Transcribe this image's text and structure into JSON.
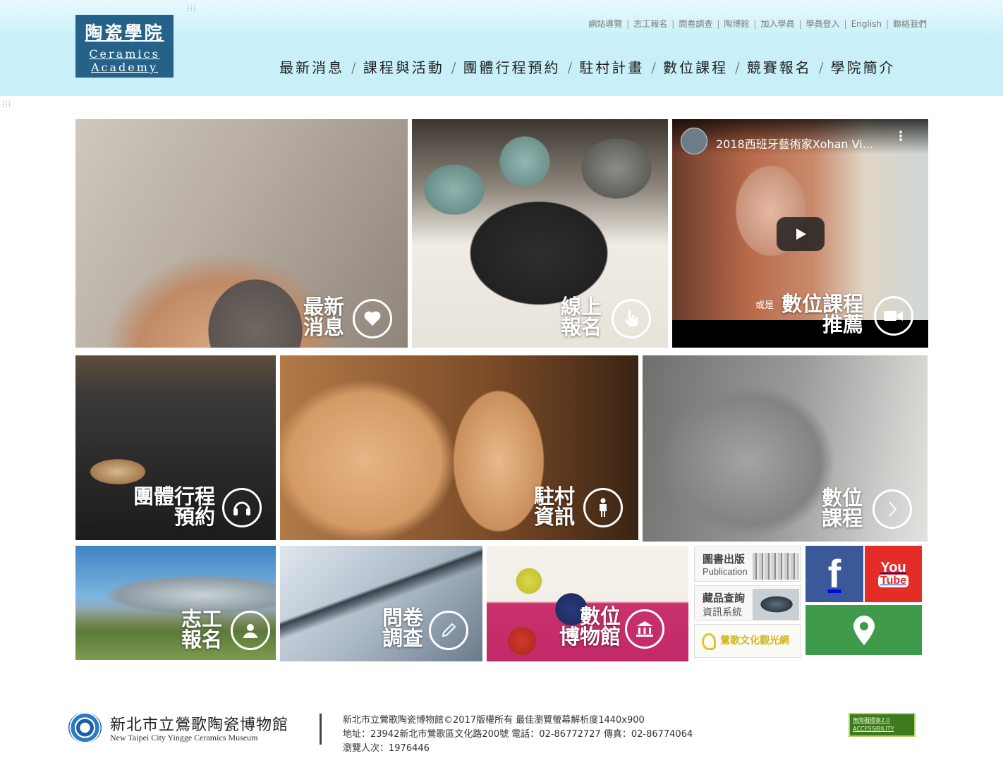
{
  "logo": {
    "cn": "陶瓷學院",
    "en_line1": "Ceramics",
    "en_line2": "Academy"
  },
  "util_nav": [
    "網站導覽",
    "志工報名",
    "問卷調查",
    "陶博館",
    "加入學員",
    "學員登入",
    "English",
    "聯絡我們"
  ],
  "main_nav": [
    "最新消息",
    "課程與活動",
    "團體行程預約",
    "駐村計畫",
    "數位課程",
    "競賽報名",
    "學院簡介"
  ],
  "tiles": {
    "news": {
      "line1": "最新",
      "line2": "消息",
      "icon": "heart-icon"
    },
    "register": {
      "line1": "線上",
      "line2": "報名",
      "icon": "hand-pointer-icon"
    },
    "video": {
      "title": "2018西班牙藝術家Xohan Vi...",
      "overlay_prefix": "或是",
      "line1": "數位課程",
      "line2": "推薦",
      "icon": "video-camera-icon"
    },
    "group": {
      "line1": "團體行程",
      "line2": "預約",
      "icon": "headphones-icon"
    },
    "residency": {
      "line1": "駐村",
      "line2": "資訊",
      "icon": "person-icon"
    },
    "digital_course": {
      "line1": "數位",
      "line2": "課程",
      "icon": "chevron-right-icon"
    },
    "volunteer": {
      "line1": "志工",
      "line2": "報名",
      "icon": "user-icon"
    },
    "survey": {
      "line1": "問卷",
      "line2": "調查",
      "icon": "pencil-icon"
    },
    "digital_museum": {
      "line1": "數位",
      "line2": "博物館",
      "icon": "museum-icon"
    }
  },
  "side_links": {
    "publication": {
      "title": "圖書出版",
      "sub": "Publication"
    },
    "collection": {
      "title": "藏品查詢",
      "sub": "資訊系統"
    },
    "tourism": {
      "title": "鶯歌文化觀光網"
    }
  },
  "social": {
    "facebook": "f",
    "youtube_line1": "You",
    "youtube_line2": "Tube"
  },
  "footer": {
    "name_cn": "新北市立鶯歌陶瓷博物館",
    "name_en": "New Taipei City Yingge Ceramics Museum",
    "copyright": "新北市立鶯歌陶瓷博物館©2017版權所有 最佳瀏覽螢幕解析度1440x900",
    "address": "地址：23942新北市鶯歌區文化路200號 電話：02-86772727 傳真：02-86774064",
    "visitors": "瀏覽人次：1976446",
    "a11y_line1": "無障礙標章2.0",
    "a11y_line2": "ACCESSIBILITY"
  },
  "colors": {
    "logo_bg": "#24628a",
    "header_bg": "#c6eff8",
    "facebook": "#3b5998",
    "youtube": "#e52d27",
    "map": "#3f9a4b"
  }
}
